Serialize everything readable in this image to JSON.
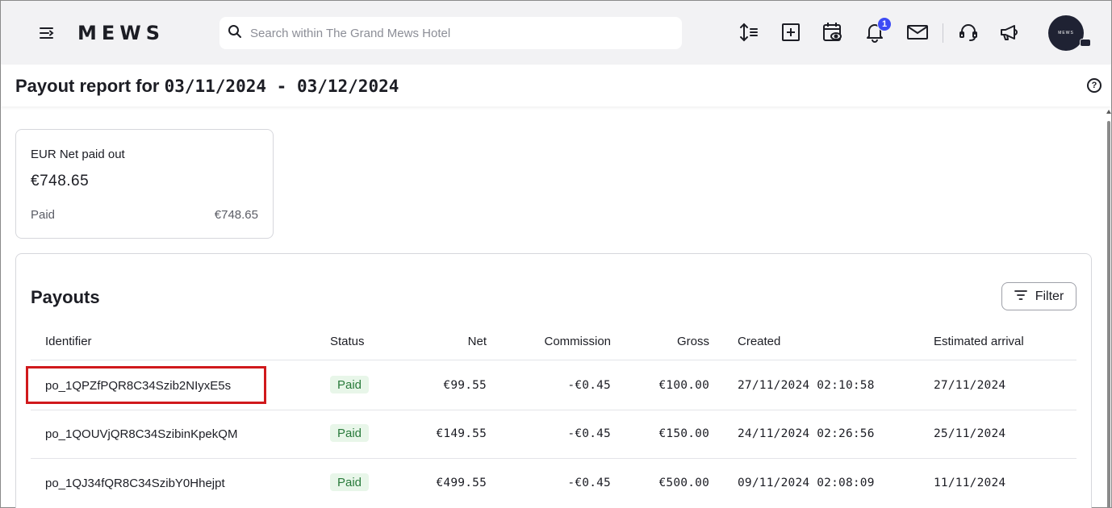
{
  "topbar": {
    "logo": "MEWS",
    "search_placeholder": "Search within The Grand Mews Hotel",
    "notification_count": "1",
    "avatar_text": "MEWS"
  },
  "page": {
    "title_prefix": "Payout report for ",
    "title_range": "03/11/2024 - 03/12/2024"
  },
  "summary": {
    "label": "EUR Net paid out",
    "amount": "€748.65",
    "paid_label": "Paid",
    "paid_amount": "€748.65"
  },
  "payouts": {
    "title": "Payouts",
    "filter_label": "Filter",
    "columns": {
      "identifier": "Identifier",
      "status": "Status",
      "net": "Net",
      "commission": "Commission",
      "gross": "Gross",
      "created": "Created",
      "arrival": "Estimated arrival"
    },
    "rows": [
      {
        "identifier": "po_1QPZfPQR8C34Szib2NIyxE5s",
        "status": "Paid",
        "net": "€99.55",
        "commission": "-€0.45",
        "gross": "€100.00",
        "created": "27/11/2024 02:10:58",
        "arrival": "27/11/2024"
      },
      {
        "identifier": "po_1QOUVjQR8C34SzibinKpekQM",
        "status": "Paid",
        "net": "€149.55",
        "commission": "-€0.45",
        "gross": "€150.00",
        "created": "24/11/2024 02:26:56",
        "arrival": "25/11/2024"
      },
      {
        "identifier": "po_1QJ34fQR8C34SzibY0Hhejpt",
        "status": "Paid",
        "net": "€499.55",
        "commission": "-€0.45",
        "gross": "€500.00",
        "created": "09/11/2024 02:08:09",
        "arrival": "11/11/2024"
      }
    ]
  },
  "colors": {
    "accent": "#3d4bf5",
    "paid_bg": "#e8f6e9",
    "paid_text": "#287a3a",
    "highlight": "#d0191c"
  }
}
